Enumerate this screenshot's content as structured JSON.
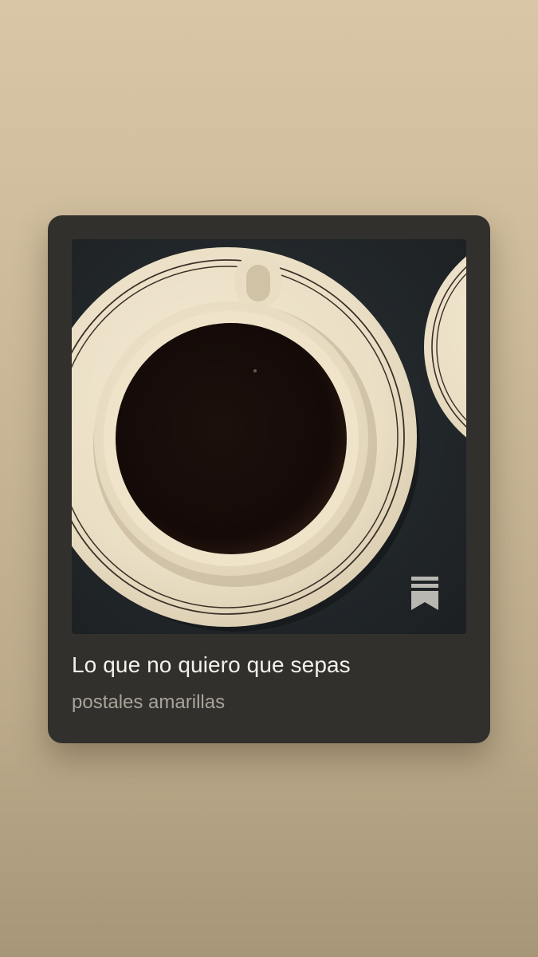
{
  "card": {
    "title": "Lo que no quiero que sepas",
    "subtitle": "postales amarillas",
    "cover_description_icon": "coffee-cup-artwork",
    "badge_icon": "substack-bookmark-icon"
  },
  "colors": {
    "background_top": "#d8c6a6",
    "background_bottom": "#a89679",
    "card": "#32302c",
    "title": "#f4f1ea",
    "subtitle": "#a9a49b"
  }
}
